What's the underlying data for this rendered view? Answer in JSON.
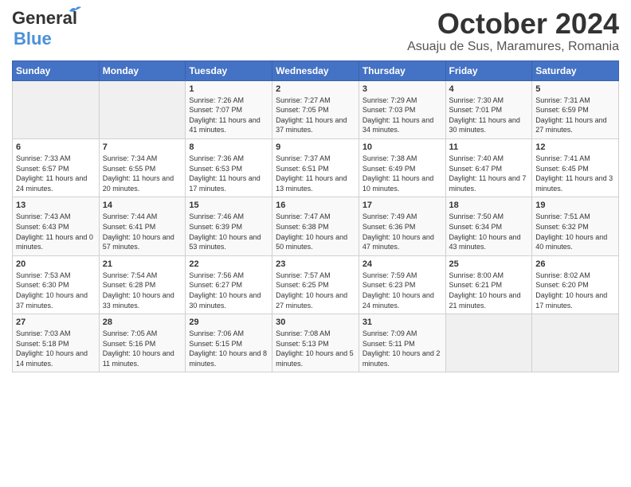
{
  "header": {
    "logo_line1": "General",
    "logo_line2": "Blue",
    "month_year": "October 2024",
    "location": "Asuaju de Sus, Maramures, Romania"
  },
  "days_of_week": [
    "Sunday",
    "Monday",
    "Tuesday",
    "Wednesday",
    "Thursday",
    "Friday",
    "Saturday"
  ],
  "weeks": [
    [
      {
        "day": "",
        "info": ""
      },
      {
        "day": "",
        "info": ""
      },
      {
        "day": "1",
        "info": "Sunrise: 7:26 AM\nSunset: 7:07 PM\nDaylight: 11 hours and 41 minutes."
      },
      {
        "day": "2",
        "info": "Sunrise: 7:27 AM\nSunset: 7:05 PM\nDaylight: 11 hours and 37 minutes."
      },
      {
        "day": "3",
        "info": "Sunrise: 7:29 AM\nSunset: 7:03 PM\nDaylight: 11 hours and 34 minutes."
      },
      {
        "day": "4",
        "info": "Sunrise: 7:30 AM\nSunset: 7:01 PM\nDaylight: 11 hours and 30 minutes."
      },
      {
        "day": "5",
        "info": "Sunrise: 7:31 AM\nSunset: 6:59 PM\nDaylight: 11 hours and 27 minutes."
      }
    ],
    [
      {
        "day": "6",
        "info": "Sunrise: 7:33 AM\nSunset: 6:57 PM\nDaylight: 11 hours and 24 minutes."
      },
      {
        "day": "7",
        "info": "Sunrise: 7:34 AM\nSunset: 6:55 PM\nDaylight: 11 hours and 20 minutes."
      },
      {
        "day": "8",
        "info": "Sunrise: 7:36 AM\nSunset: 6:53 PM\nDaylight: 11 hours and 17 minutes."
      },
      {
        "day": "9",
        "info": "Sunrise: 7:37 AM\nSunset: 6:51 PM\nDaylight: 11 hours and 13 minutes."
      },
      {
        "day": "10",
        "info": "Sunrise: 7:38 AM\nSunset: 6:49 PM\nDaylight: 11 hours and 10 minutes."
      },
      {
        "day": "11",
        "info": "Sunrise: 7:40 AM\nSunset: 6:47 PM\nDaylight: 11 hours and 7 minutes."
      },
      {
        "day": "12",
        "info": "Sunrise: 7:41 AM\nSunset: 6:45 PM\nDaylight: 11 hours and 3 minutes."
      }
    ],
    [
      {
        "day": "13",
        "info": "Sunrise: 7:43 AM\nSunset: 6:43 PM\nDaylight: 11 hours and 0 minutes."
      },
      {
        "day": "14",
        "info": "Sunrise: 7:44 AM\nSunset: 6:41 PM\nDaylight: 10 hours and 57 minutes."
      },
      {
        "day": "15",
        "info": "Sunrise: 7:46 AM\nSunset: 6:39 PM\nDaylight: 10 hours and 53 minutes."
      },
      {
        "day": "16",
        "info": "Sunrise: 7:47 AM\nSunset: 6:38 PM\nDaylight: 10 hours and 50 minutes."
      },
      {
        "day": "17",
        "info": "Sunrise: 7:49 AM\nSunset: 6:36 PM\nDaylight: 10 hours and 47 minutes."
      },
      {
        "day": "18",
        "info": "Sunrise: 7:50 AM\nSunset: 6:34 PM\nDaylight: 10 hours and 43 minutes."
      },
      {
        "day": "19",
        "info": "Sunrise: 7:51 AM\nSunset: 6:32 PM\nDaylight: 10 hours and 40 minutes."
      }
    ],
    [
      {
        "day": "20",
        "info": "Sunrise: 7:53 AM\nSunset: 6:30 PM\nDaylight: 10 hours and 37 minutes."
      },
      {
        "day": "21",
        "info": "Sunrise: 7:54 AM\nSunset: 6:28 PM\nDaylight: 10 hours and 33 minutes."
      },
      {
        "day": "22",
        "info": "Sunrise: 7:56 AM\nSunset: 6:27 PM\nDaylight: 10 hours and 30 minutes."
      },
      {
        "day": "23",
        "info": "Sunrise: 7:57 AM\nSunset: 6:25 PM\nDaylight: 10 hours and 27 minutes."
      },
      {
        "day": "24",
        "info": "Sunrise: 7:59 AM\nSunset: 6:23 PM\nDaylight: 10 hours and 24 minutes."
      },
      {
        "day": "25",
        "info": "Sunrise: 8:00 AM\nSunset: 6:21 PM\nDaylight: 10 hours and 21 minutes."
      },
      {
        "day": "26",
        "info": "Sunrise: 8:02 AM\nSunset: 6:20 PM\nDaylight: 10 hours and 17 minutes."
      }
    ],
    [
      {
        "day": "27",
        "info": "Sunrise: 7:03 AM\nSunset: 5:18 PM\nDaylight: 10 hours and 14 minutes."
      },
      {
        "day": "28",
        "info": "Sunrise: 7:05 AM\nSunset: 5:16 PM\nDaylight: 10 hours and 11 minutes."
      },
      {
        "day": "29",
        "info": "Sunrise: 7:06 AM\nSunset: 5:15 PM\nDaylight: 10 hours and 8 minutes."
      },
      {
        "day": "30",
        "info": "Sunrise: 7:08 AM\nSunset: 5:13 PM\nDaylight: 10 hours and 5 minutes."
      },
      {
        "day": "31",
        "info": "Sunrise: 7:09 AM\nSunset: 5:11 PM\nDaylight: 10 hours and 2 minutes."
      },
      {
        "day": "",
        "info": ""
      },
      {
        "day": "",
        "info": ""
      }
    ]
  ]
}
